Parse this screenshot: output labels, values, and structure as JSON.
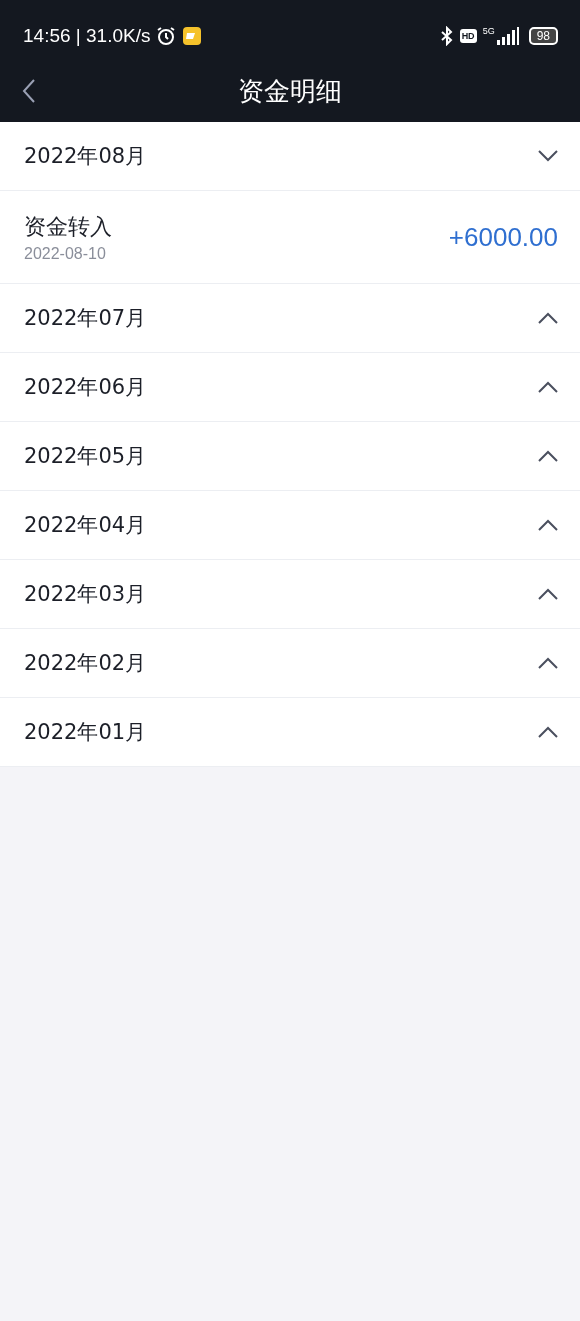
{
  "status_bar": {
    "time": "14:56 | 31.0K/s",
    "hd": "HD",
    "network": "5G",
    "battery": "98"
  },
  "nav": {
    "title": "资金明细"
  },
  "months": [
    {
      "label": "2022年08月",
      "expanded": true,
      "entries": [
        {
          "title": "资金转入",
          "date": "2022-08-10",
          "amount": "+6000.00"
        }
      ]
    },
    {
      "label": "2022年07月",
      "expanded": false
    },
    {
      "label": "2022年06月",
      "expanded": false
    },
    {
      "label": "2022年05月",
      "expanded": false
    },
    {
      "label": "2022年04月",
      "expanded": false
    },
    {
      "label": "2022年03月",
      "expanded": false
    },
    {
      "label": "2022年02月",
      "expanded": false
    },
    {
      "label": "2022年01月",
      "expanded": false
    }
  ]
}
